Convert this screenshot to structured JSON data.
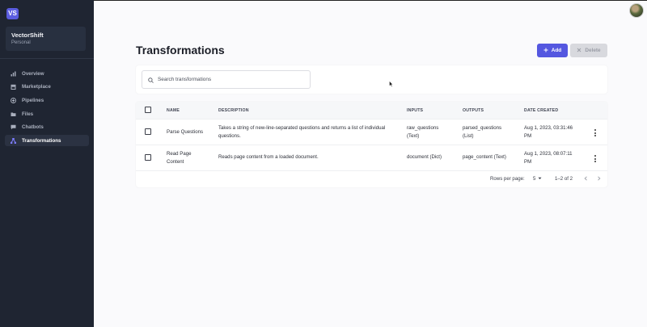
{
  "sidebar": {
    "logo_text": "VS",
    "workspace_name": "VectorShift",
    "workspace_type": "Personal",
    "items": [
      {
        "label": "Overview",
        "icon": "bar-chart-icon",
        "active": false
      },
      {
        "label": "Marketplace",
        "icon": "store-icon",
        "active": false
      },
      {
        "label": "Pipelines",
        "icon": "pipeline-icon",
        "active": false
      },
      {
        "label": "Files",
        "icon": "folder-icon",
        "active": false
      },
      {
        "label": "Chatbots",
        "icon": "chat-icon",
        "active": false
      },
      {
        "label": "Transformations",
        "icon": "transform-icon",
        "active": true
      }
    ]
  },
  "header": {
    "title": "Transformations",
    "add_label": "Add",
    "delete_label": "Delete"
  },
  "search": {
    "placeholder": "Search transformations",
    "value": ""
  },
  "table": {
    "columns": [
      "NAME",
      "DESCRIPTION",
      "INPUTS",
      "OUTPUTS",
      "DATE CREATED"
    ],
    "rows": [
      {
        "name": "Parse Questions",
        "description": "Takes a string of new-line-separated questions and returns a list of individual questions.",
        "inputs": "raw_questions (Text)",
        "outputs": "parsed_questions (List)",
        "date": "Aug 1, 2023, 03:31:46 PM"
      },
      {
        "name": "Read Page Content",
        "description": "Reads page content from a loaded document.",
        "inputs": "document (Dict)",
        "outputs": "page_content (Text)",
        "date": "Aug 1, 2023, 08:07:11 PM"
      }
    ]
  },
  "pagination": {
    "rows_per_page_label": "Rows per page:",
    "rows_per_page_value": "5",
    "range_text": "1–2 of 2"
  },
  "colors": {
    "sidebar_bg": "#1f2532",
    "accent": "#5457e0",
    "page_bg": "#fafafc"
  }
}
